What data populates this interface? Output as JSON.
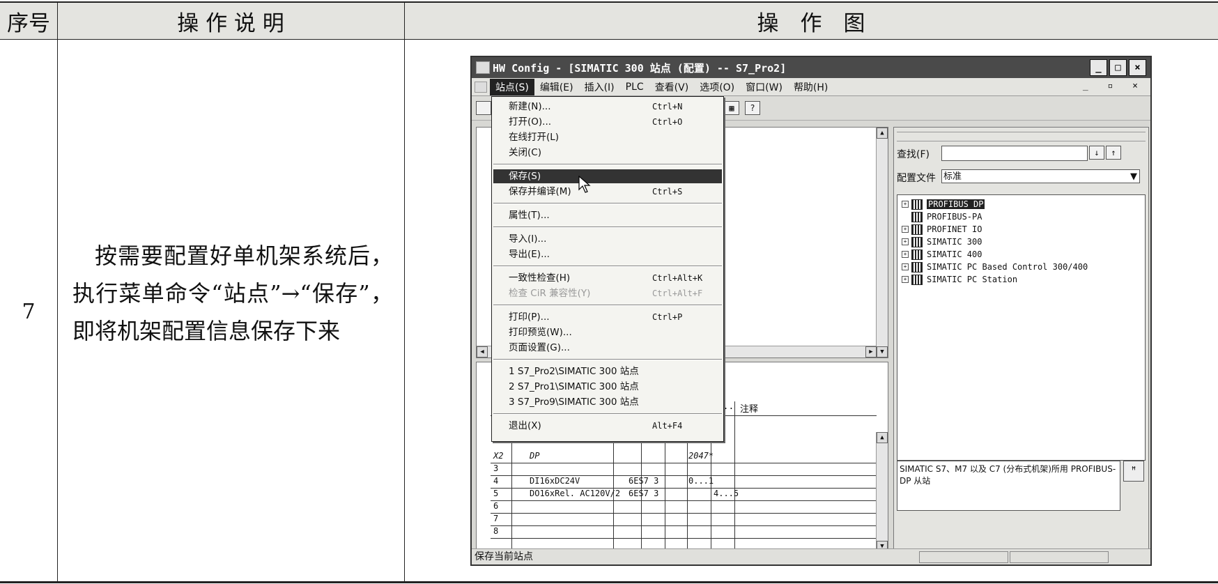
{
  "table": {
    "headers": [
      "序号",
      "操 作 说 明",
      "操　作　图"
    ],
    "row": {
      "number": "7",
      "description": "按需要配置好单机架系统后，执行菜单命令“站点”→“保存”，即将机架配置信息保存下来"
    }
  },
  "window": {
    "title": "HW Config - [SIMATIC 300 站点 (配置) -- S7_Pro2]",
    "controls": [
      "_",
      "□",
      "×"
    ],
    "menu": [
      "站点(S)",
      "编辑(E)",
      "插入(I)",
      "PLC",
      "查看(V)",
      "选项(O)",
      "窗口(W)",
      "帮助(H)"
    ],
    "mdi_controls": "_ ▫ ×",
    "status_text": "保存当前站点"
  },
  "dropdown": {
    "items": [
      {
        "label": "新建(N)...",
        "shortcut": "Ctrl+N"
      },
      {
        "label": "打开(O)...",
        "shortcut": "Ctrl+O"
      },
      {
        "label": "在线打开(L)",
        "shortcut": ""
      },
      {
        "label": "关闭(C)",
        "shortcut": ""
      },
      {
        "label": "保存(S)",
        "shortcut": ""
      },
      {
        "label": "保存并编译(M)",
        "shortcut": "Ctrl+S"
      },
      {
        "label": "属性(T)...",
        "shortcut": ""
      },
      {
        "label": "导入(I)...",
        "shortcut": ""
      },
      {
        "label": "导出(E)...",
        "shortcut": ""
      },
      {
        "label": "一致性检查(H)",
        "shortcut": "Ctrl+Alt+K"
      },
      {
        "label": "检查 CiR 兼容性(Y)",
        "shortcut": "Ctrl+Alt+F"
      },
      {
        "label": "打印(P)...",
        "shortcut": "Ctrl+P"
      },
      {
        "label": "打印预览(W)...",
        "shortcut": ""
      },
      {
        "label": "页面设置(G)...",
        "shortcut": ""
      },
      {
        "label": "1 S7_Pro2\\SIMATIC 300 站点",
        "shortcut": ""
      },
      {
        "label": "2 S7_Pro1\\SIMATIC 300 站点",
        "shortcut": ""
      },
      {
        "label": "3 S7_Pro9\\SIMATIC 300 站点",
        "shortcut": ""
      },
      {
        "label": "退出(X)",
        "shortcut": "Alt+F4"
      }
    ]
  },
  "rack_table": {
    "headers": [
      "Q...",
      "注释"
    ],
    "rows": [
      {
        "slot": "X2",
        "module": "DP",
        "order": "",
        "i": "2047*",
        "q": ""
      },
      {
        "slot": "3",
        "module": "",
        "order": "",
        "i": "",
        "q": ""
      },
      {
        "slot": "4",
        "module": "DI16xDC24V",
        "order": "6ES7 3",
        "i": "0...1",
        "q": ""
      },
      {
        "slot": "5",
        "module": "DO16xRel. AC120V/2",
        "order": "6ES7 3",
        "i": "",
        "q": "4...5"
      },
      {
        "slot": "6",
        "module": "",
        "order": "",
        "i": "",
        "q": ""
      },
      {
        "slot": "7",
        "module": "",
        "order": "",
        "i": "",
        "q": ""
      },
      {
        "slot": "8",
        "module": "",
        "order": "",
        "i": "",
        "q": ""
      }
    ]
  },
  "catalog": {
    "find_label": "查找(F)",
    "profile_label": "配置文件",
    "profile_value": "标准",
    "tree": [
      "PROFIBUS DP",
      "PROFIBUS-PA",
      "PROFINET IO",
      "SIMATIC 300",
      "SIMATIC 400",
      "SIMATIC PC Based Control 300/400",
      "SIMATIC PC Station"
    ],
    "info": "SIMATIC S7、M7 以及 C7 (分布式机架)所用 PROFIBUS-DP 从站"
  }
}
